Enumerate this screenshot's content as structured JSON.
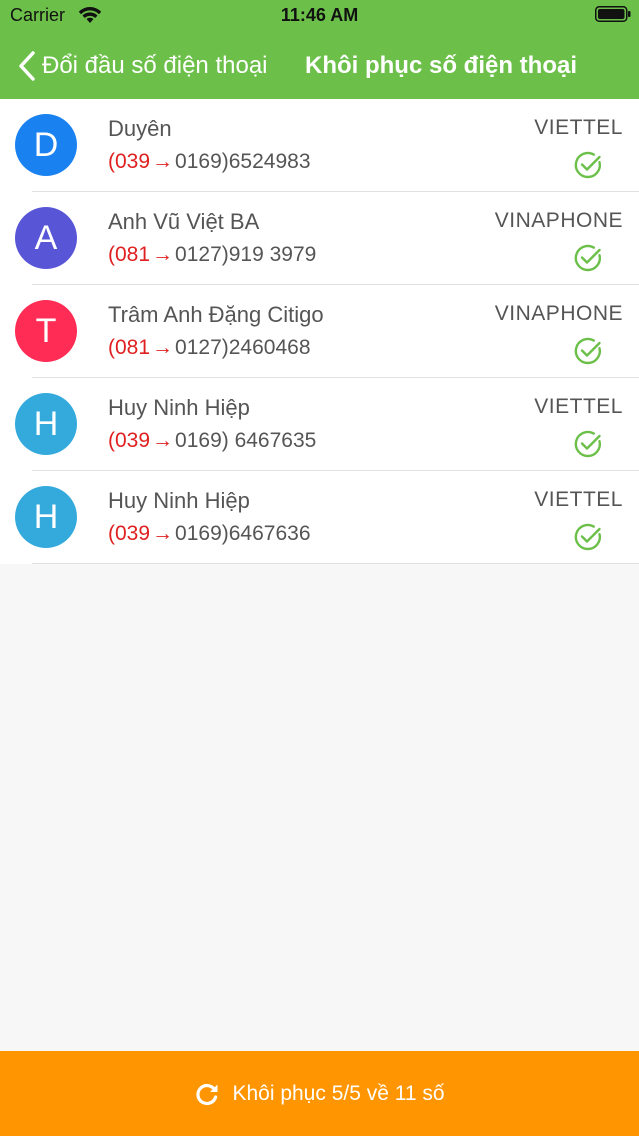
{
  "status_bar": {
    "carrier": "Carrier",
    "time": "11:46 AM"
  },
  "nav": {
    "back_label": "Đổi đầu số điện thoại",
    "title": "Khôi phục số điện thoại"
  },
  "contacts": [
    {
      "initial": "D",
      "name": "Duyên",
      "new_prefix": "(039",
      "arrow": "→",
      "old_number": "0169)6524983",
      "carrier": "VIETTEL",
      "avatar_color": "#1a82f0"
    },
    {
      "initial": "A",
      "name": "Anh Vũ Việt BA",
      "new_prefix": "(081",
      "arrow": "→",
      "old_number": "0127)919 3979",
      "carrier": "VINAPHONE",
      "avatar_color": "#5856d6"
    },
    {
      "initial": "T",
      "name": "Trâm Anh Đặng Citigo",
      "new_prefix": "(081",
      "arrow": "→",
      "old_number": "0127)2460468",
      "carrier": "VINAPHONE",
      "avatar_color": "#ff2d55"
    },
    {
      "initial": "H",
      "name": "Huy Ninh Hiệp",
      "new_prefix": "(039",
      "arrow": "→",
      "old_number": "0169) 6467635",
      "carrier": "VIETTEL",
      "avatar_color": "#34aadc"
    },
    {
      "initial": "H",
      "name": "Huy Ninh Hiệp",
      "new_prefix": "(039",
      "arrow": "→",
      "old_number": "0169)6467636",
      "carrier": "VIETTEL",
      "avatar_color": "#34aadc"
    }
  ],
  "bottom_button": {
    "label": "Khôi phục 5/5 về 11 số",
    "icon": "refresh-icon"
  },
  "colors": {
    "nav_green": "#6cc04a",
    "check_green": "#6cc04a",
    "bottom_orange": "#ff9500",
    "prefix_red": "#e02020"
  }
}
